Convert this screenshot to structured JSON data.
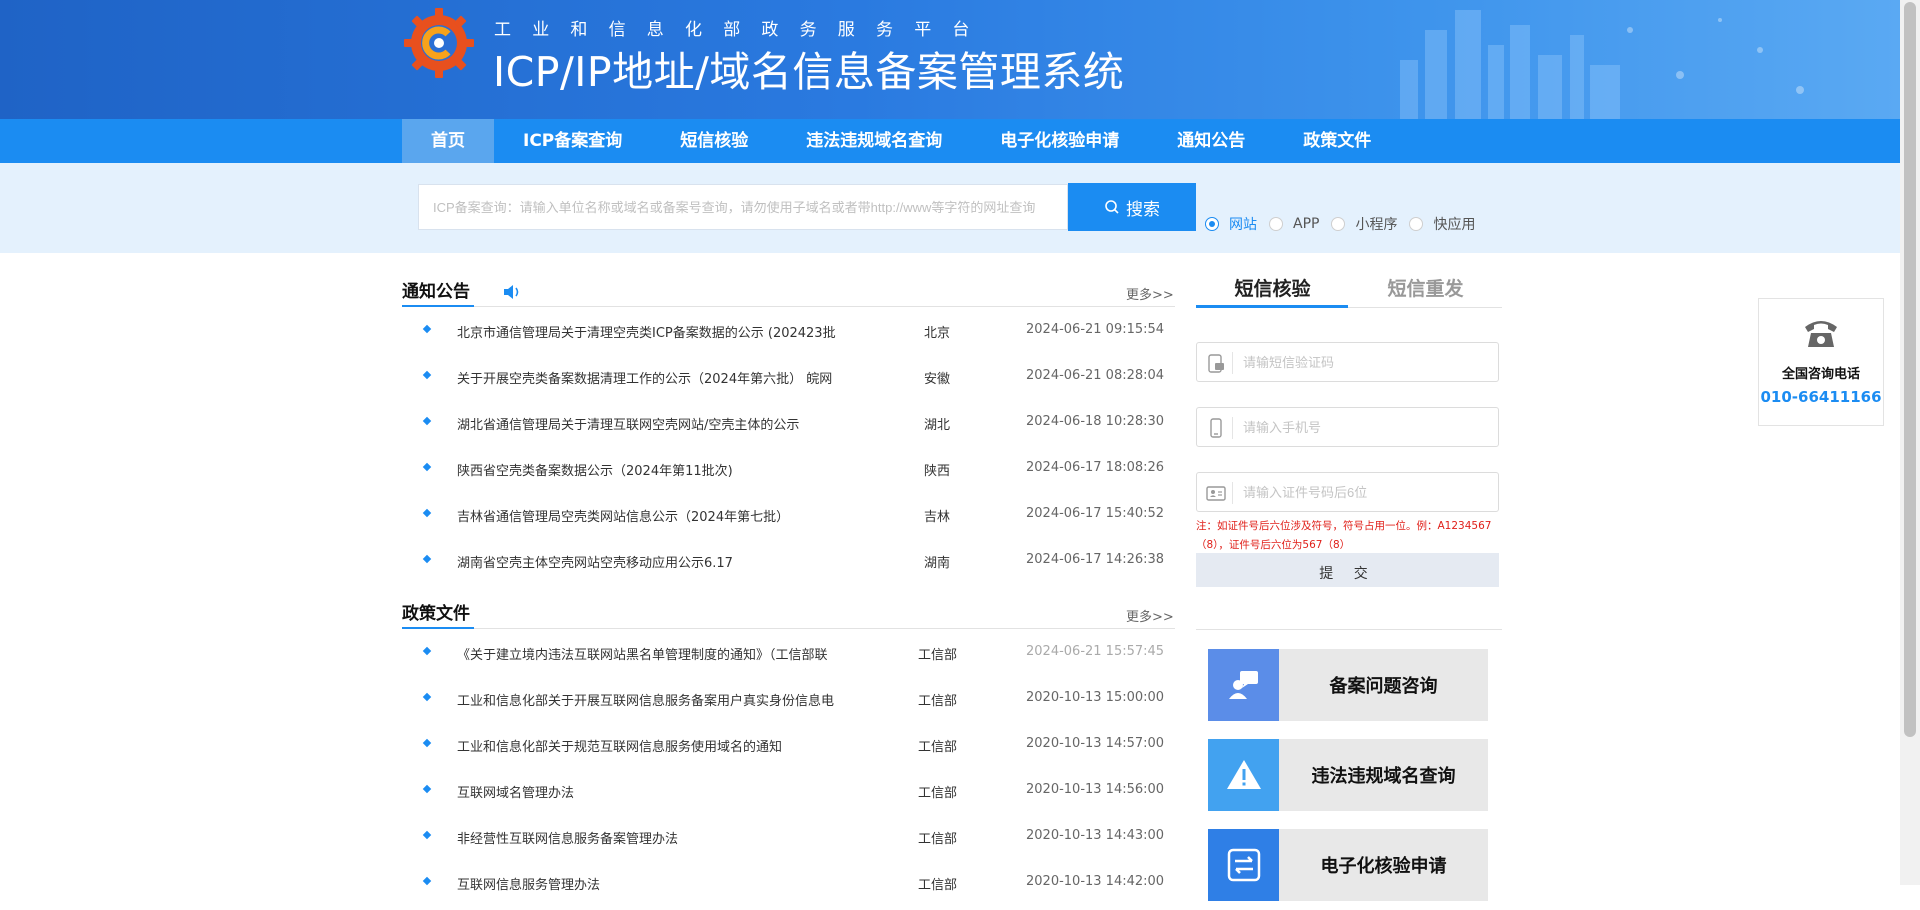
{
  "header": {
    "subtitle": "工业和信息化部政务服务平台",
    "title": "ICP/IP地址/域名信息备案管理系统"
  },
  "nav": {
    "items": [
      {
        "label": "首页",
        "active": true
      },
      {
        "label": "ICP备案查询",
        "active": false
      },
      {
        "label": "短信核验",
        "active": false
      },
      {
        "label": "违法违规域名查询",
        "active": false
      },
      {
        "label": "电子化核验申请",
        "active": false
      },
      {
        "label": "通知公告",
        "active": false
      },
      {
        "label": "政策文件",
        "active": false
      }
    ]
  },
  "search": {
    "placeholder": "ICP备案查询：请输入单位名称或域名或备案号查询，请勿使用子域名或者带http://www等字符的网址查询",
    "button_label": "搜索",
    "radio_options": [
      {
        "label": "网站",
        "selected": true
      },
      {
        "label": "APP",
        "selected": false
      },
      {
        "label": "小程序",
        "selected": false
      },
      {
        "label": "快应用",
        "selected": false
      }
    ]
  },
  "notices": {
    "title": "通知公告",
    "more": "更多>>",
    "items": [
      {
        "title": "北京市通信管理局关于清理空壳类ICP备案数据的公示 (202423批",
        "region": "北京",
        "date": "2024-06-21 09:15:54"
      },
      {
        "title": "关于开展空壳类备案数据清理工作的公示（2024年第六批） 皖网",
        "region": "安徽",
        "date": "2024-06-21 08:28:04"
      },
      {
        "title": "湖北省通信管理局关于清理互联网空壳网站/空壳主体的公示",
        "region": "湖北",
        "date": "2024-06-18 10:28:30"
      },
      {
        "title": "陕西省空壳类备案数据公示（2024年第11批次)",
        "region": "陕西",
        "date": "2024-06-17 18:08:26"
      },
      {
        "title": "吉林省通信管理局空壳类网站信息公示（2024年第七批）",
        "region": "吉林",
        "date": "2024-06-17 15:40:52"
      },
      {
        "title": "湖南省空壳主体空壳网站空壳移动应用公示6.17",
        "region": "湖南",
        "date": "2024-06-17 14:26:38"
      }
    ]
  },
  "policies": {
    "title": "政策文件",
    "more": "更多>>",
    "items": [
      {
        "title": "《关于建立境内违法互联网站黑名单管理制度的通知》（工信部联",
        "region": "工信部",
        "date": "2024-06-21 15:57:45"
      },
      {
        "title": "工业和信息化部关于开展互联网信息服务备案用户真实身份信息电",
        "region": "工信部",
        "date": "2020-10-13 15:00:00"
      },
      {
        "title": "工业和信息化部关于规范互联网信息服务使用域名的通知",
        "region": "工信部",
        "date": "2020-10-13 14:57:00"
      },
      {
        "title": "互联网域名管理办法",
        "region": "工信部",
        "date": "2020-10-13 14:56:00"
      },
      {
        "title": "非经营性互联网信息服务备案管理办法",
        "region": "工信部",
        "date": "2020-10-13 14:43:00"
      },
      {
        "title": "互联网信息服务管理办法",
        "region": "工信部",
        "date": "2020-10-13 14:42:00"
      }
    ]
  },
  "sms": {
    "tabs": [
      {
        "label": "短信核验",
        "active": true
      },
      {
        "label": "短信重发",
        "active": false
      }
    ],
    "code_placeholder": "请输短信验证码",
    "phone_placeholder": "请输入手机号",
    "id_placeholder": "请输入证件号码后6位",
    "note": "注：如证件号后六位涉及符号，符号占用一位。例：A1234567（8），证件号后六位为567（8）",
    "submit_label": "提 交"
  },
  "quick_links": [
    {
      "label": "备案问题咨询",
      "icon": "consult-icon",
      "color": "#5b8de8"
    },
    {
      "label": "违法违规域名查询",
      "icon": "warning-icon",
      "color": "#42a2f0"
    },
    {
      "label": "电子化核验申请",
      "icon": "transfer-icon",
      "color": "#2f7fe6"
    }
  ],
  "hotline": {
    "label": "全国咨询电话",
    "number": "010-66411166"
  },
  "colors": {
    "accent": "#1b8cf2",
    "nav_active": "#5aa6ee",
    "search_band": "#e4f1fd",
    "note_red": "#e0201a"
  }
}
